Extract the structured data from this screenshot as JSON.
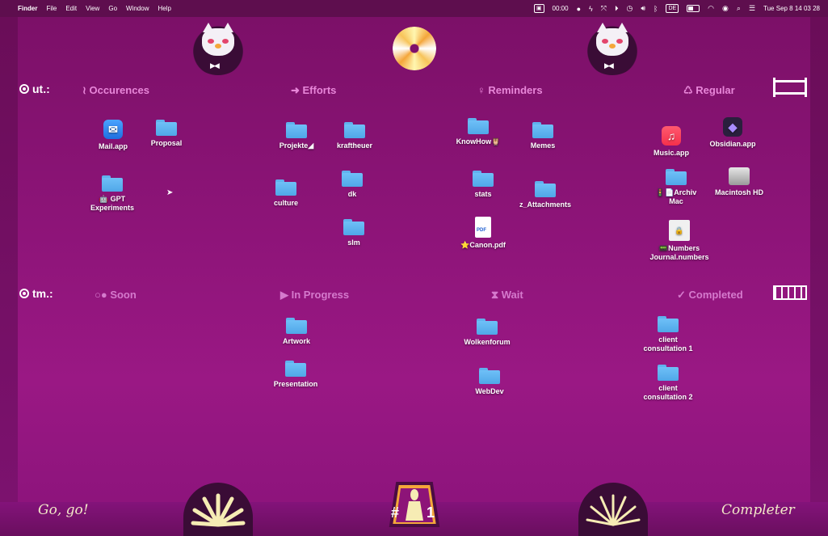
{
  "menubar": {
    "app": "Finder",
    "menus": [
      "File",
      "Edit",
      "View",
      "Go",
      "Window",
      "Help"
    ],
    "timer": "00:00",
    "input_source": "DE",
    "datetime": "Tue Sep 8  14 03 28"
  },
  "rows": {
    "ut": "ut.:",
    "tm": "tm.:"
  },
  "columns_top": {
    "occurences": "≀ Occurences",
    "efforts": "➜ Efforts",
    "reminders": "♀ Reminders",
    "regular": "♺ Regular"
  },
  "columns_bottom": {
    "soon": "○● Soon",
    "in_progress": "▶ In Progress",
    "wait": "⧗ Wait",
    "completed": "✓ Completed"
  },
  "icons": {
    "mail": "Mail.app",
    "proposal": "Proposal",
    "gpt_line1": "🤖 GPT",
    "gpt_line2": "Experiments",
    "projekte": "Projekte◢",
    "kraftheuer": "kraftheuer",
    "culture": "culture",
    "dk": "dk",
    "slm": "slm",
    "knowhow": "KnowHow🦉",
    "memes": "Memes",
    "stats": "stats",
    "z_attachments": "z_Attachments",
    "canon": "⭐Canon.pdf",
    "music": "Music.app",
    "obsidian": "Obsidian.app",
    "archiv_line1": "🚦📄Archiv",
    "archiv_line2": "Mac",
    "macintosh": "Macintosh HD",
    "numbers_line1": "📟Numbers",
    "numbers_line2": "Journal.numbers",
    "artwork": "Artwork",
    "presentation": "Presentation",
    "wolkenforum": "Wolkenforum",
    "webdev": "WebDev",
    "client1_line1": "client",
    "client1_line2": "consultation 1",
    "client2_line1": "client",
    "client2_line2": "consultation 2"
  },
  "footer": {
    "go": "Go, go!",
    "completer": "Completer",
    "badge_hash": "#",
    "badge_num": "1"
  }
}
